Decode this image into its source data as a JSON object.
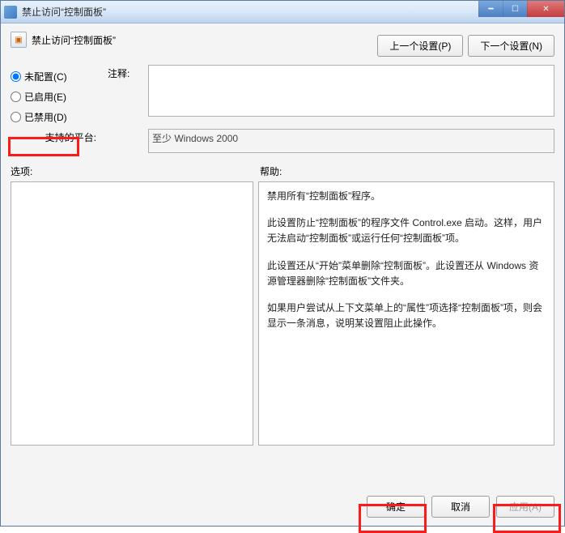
{
  "window": {
    "title": "禁止访问“控制面板”"
  },
  "header": {
    "policy_title": "禁止访问“控制面板”",
    "prev_btn": "上一个设置(P)",
    "next_btn": "下一个设置(N)"
  },
  "state": {
    "not_configured": "未配置(C)",
    "enabled": "已启用(E)",
    "disabled": "已禁用(D)",
    "selected": "not_configured"
  },
  "labels": {
    "comment": "注释:",
    "platform": "支持的平台:",
    "options": "选项:",
    "help": "帮助:"
  },
  "fields": {
    "comment_value": "",
    "platform_value": "至少 Windows 2000"
  },
  "help_paragraphs": [
    "禁用所有“控制面板”程序。",
    "此设置防止“控制面板”的程序文件 Control.exe 启动。这样，用户无法启动“控制面板”或运行任何“控制面板”项。",
    "此设置还从“开始”菜单删除“控制面板”。此设置还从 Windows 资源管理器删除“控制面板”文件夹。",
    "如果用户尝试从上下文菜单上的“属性”项选择“控制面板”项，则会显示一条消息，说明某设置阻止此操作。"
  ],
  "footer": {
    "ok": "确定",
    "cancel": "取消",
    "apply": "应用(A)"
  }
}
